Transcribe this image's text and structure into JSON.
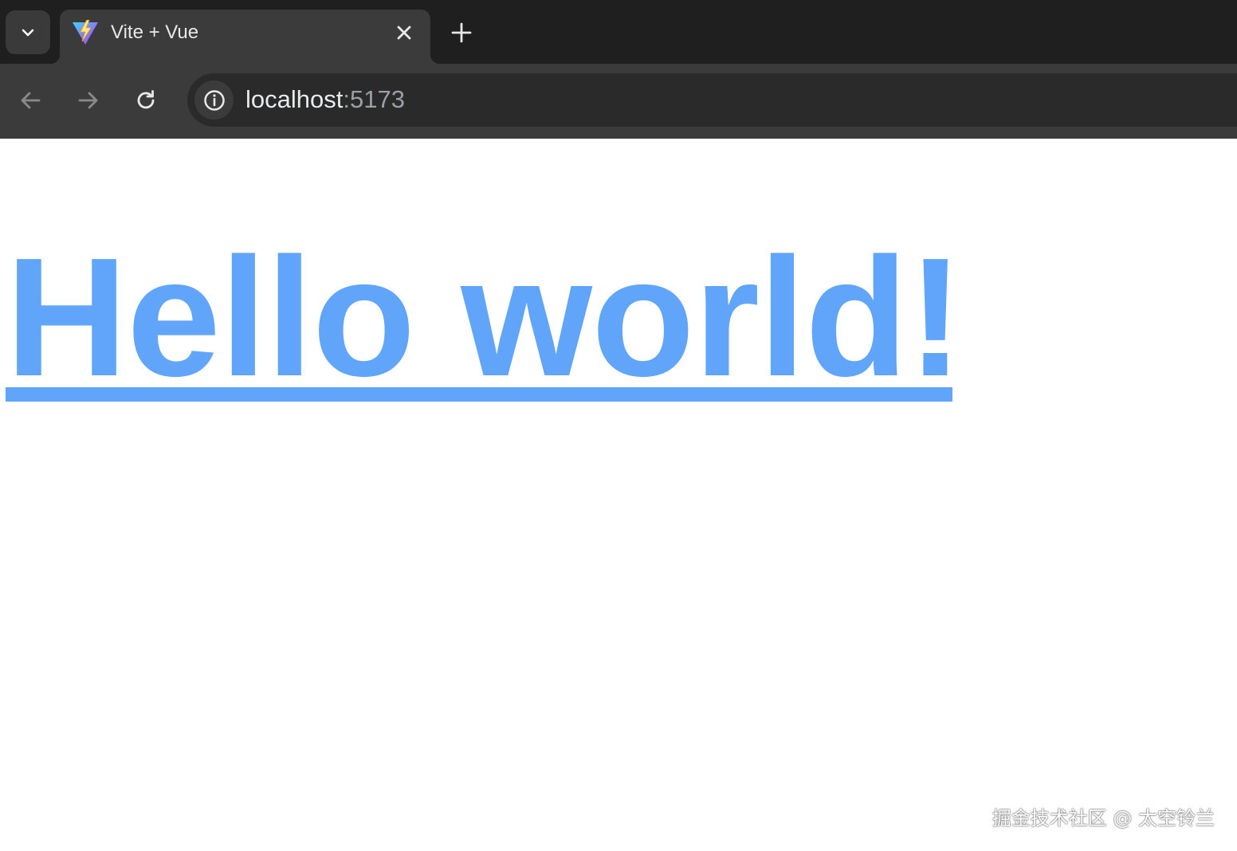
{
  "browser": {
    "tab": {
      "title": "Vite + Vue",
      "favicon": "vite-logo-icon"
    },
    "address_bar": {
      "host": "localhost",
      "port": ":5173"
    }
  },
  "page": {
    "heading": "Hello world!",
    "heading_color": "#60a5fa"
  },
  "watermark": "掘金技术社区 @ 太空铃兰"
}
